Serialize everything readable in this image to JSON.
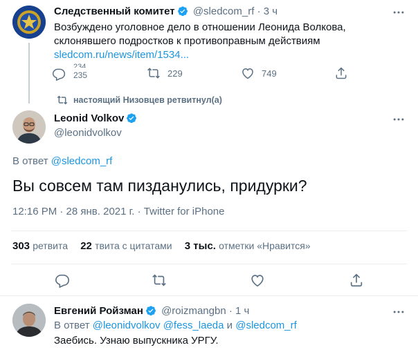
{
  "tweet1": {
    "display_name": "Следственный комитет",
    "handle": "@sledcom_rf",
    "dot": "·",
    "time": "3 ч",
    "text_line1": "Возбуждено уголовное дело в отношении Леонида Волкова,",
    "text_line2": "склонявшего подростков к противоправным действиям",
    "link": "sledcom.ru/news/item/1534...",
    "reply_count_top": "234",
    "reply_count": "235",
    "retweet_count": "229",
    "like_count": "749"
  },
  "retweet_notice": "настоящий Низовцев ретвитнул(а)",
  "main_tweet": {
    "display_name": "Leonid Volkov",
    "handle": "@leonidvolkov",
    "reply_prefix": "В ответ",
    "reply_to": "@sledcom_rf",
    "text": "Вы совсем там пизданулись, придурки?",
    "timestamp": "12:16 PM · 28 янв. 2021 г. · Twitter for iPhone",
    "stats": {
      "retweets_value": "303",
      "retweets_label": "ретвита",
      "quotes_value": "22",
      "quotes_label": "твита с цитатами",
      "likes_value": "3 тыс.",
      "likes_label": "отметки «Нравится»"
    }
  },
  "reply_tweet": {
    "display_name": "Евгений Ройзман",
    "handle": "@roizmangbn",
    "dot": "·",
    "time": "1 ч",
    "reply_prefix": "В ответ",
    "mention1": "@leonidvolkov",
    "mention2": "@fess_laeda",
    "and": "и",
    "mention3": "@sledcom_rf",
    "text": "Заебись. Узнаю выпускника УРГУ."
  },
  "colors": {
    "accent": "#1da1f2",
    "link": "#1b95e0",
    "muted": "#5b7083",
    "divider": "#ebeef0"
  }
}
